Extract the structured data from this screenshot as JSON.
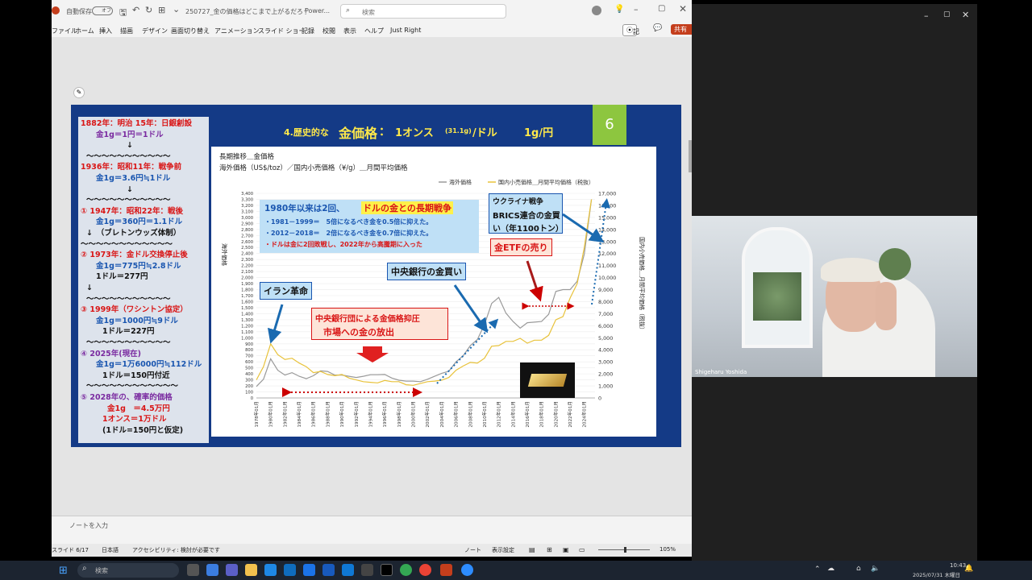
{
  "titlebar": {
    "autosave": "自動保存",
    "toggle": "オフ",
    "filename": "250727_金の価格はどこまで上がるだろうか.pptx",
    "app": "Power...",
    "search_placeholder": "検索"
  },
  "ribbon": {
    "tabs": [
      "ファイル",
      "ホーム",
      "挿入",
      "描画",
      "デザイン",
      "画面切り替え",
      "アニメーション",
      "スライド ショー",
      "記録",
      "校閲",
      "表示",
      "ヘルプ",
      "Just Right"
    ],
    "record": "記録",
    "share": "共有"
  },
  "slide": {
    "number": "6",
    "title_prefix": "4.歴史的な",
    "title_main": "金価格",
    "title_colon": "：",
    "title_unit": "1オンス",
    "title_gram": "(31.1g)",
    "title_per": "/ドル",
    "title_right": "1g/円",
    "left_panel": [
      {
        "text": "1882年：明治 15年：日銀創設",
        "color": "red"
      },
      {
        "text": "金1g＝1円＝1ドル",
        "color": "purp"
      },
      {
        "text": "↓",
        "color": "blk"
      },
      {
        "text": "～～～～～～～～～～～",
        "color": "blk"
      },
      {
        "text": "1936年：昭和11年：戦争前",
        "color": "red"
      },
      {
        "text": "金1g＝3.6円≒1ドル",
        "color": "blue"
      },
      {
        "text": "↓",
        "color": "blk"
      },
      {
        "text": "～～～～～～～～～～～",
        "color": "blk"
      },
      {
        "text": "① 1947年：昭和22年：戦後",
        "color": "red"
      },
      {
        "text": "金1g＝360円＝1.1ドル",
        "color": "blue"
      },
      {
        "text": "↓　（ブレトンウッズ体制）",
        "color": "blk"
      },
      {
        "text": "～～～～～～～～～～～～",
        "color": "blk"
      },
      {
        "text": "② 1973年：金ドル交換停止後",
        "color": "red"
      },
      {
        "text": "金1g＝775円≒2.8ドル",
        "color": "blue"
      },
      {
        "text": "1ドル＝277円",
        "color": "blk"
      },
      {
        "text": "↓",
        "color": "blk"
      },
      {
        "text": "～～～～～～～～～～～",
        "color": "blk"
      },
      {
        "text": "③ 1999年（ワシントン協定）",
        "color": "red"
      },
      {
        "text": "金1g＝1000円≒9ドル",
        "color": "blue"
      },
      {
        "text": "1ドル＝227円",
        "color": "blk"
      },
      {
        "text": "～～～～～～～～～～～",
        "color": "blk"
      },
      {
        "text": "④ 2025年(現在)",
        "color": "purp"
      },
      {
        "text": "金1g＝1万6000円≒112ドル",
        "color": "blue"
      },
      {
        "text": "1ドル＝150円付近",
        "color": "blk"
      },
      {
        "text": "～～～～～～～～～～～～",
        "color": "blk"
      },
      {
        "text": "⑤ 2028年の、確率的価格",
        "color": "purp"
      },
      {
        "text": "金1g　＝4.5万円",
        "color": "red"
      },
      {
        "text": "1オンス＝1万ドル",
        "color": "red"
      },
      {
        "text": "(1ドル=150円と仮定)",
        "color": "blk"
      }
    ],
    "annotations": {
      "box1_title": "1980年以来は2回、",
      "box1_title_hl": "ドルの金との長期戦争",
      "box1_l1": "・1981－1999＝　5倍になるべき金を0.5倍に抑えた。",
      "box1_l2": "・2012－2018＝　2倍になるべき金を0.7倍に抑えた。",
      "box1_l3": "・ドルは金に2回敗戦し、2022年から高騰期に入った",
      "iran": "イラン革命",
      "cb_buy": "中央銀行の金買い",
      "ukraine_1": "ウクライナ戦争",
      "ukraine_2": "BRICS連合の金買",
      "ukraine_3": "い（年1100トン）",
      "etf": "金ETFの売り",
      "suppress_1": "中央銀行団による金価格抑圧",
      "suppress_2": "市場への金の放出"
    }
  },
  "chart_data": {
    "type": "line",
    "title": "長期推移＿金価格",
    "subtitle": "海外価格（US$/toz）／国内小売価格（¥/g）＿月間平均価格",
    "ylabel": "海外価格",
    "y2label": "国内小売価格＿月間平均価格（税抜）",
    "ylim": [
      0,
      3400
    ],
    "y2lim": [
      0,
      17000
    ],
    "y_ticks": [
      "3,400",
      "3,300",
      "3,200",
      "3,100",
      "3,000",
      "2,900",
      "2,800",
      "2,700",
      "2,600",
      "2,500",
      "2,400",
      "2,300",
      "2,200",
      "2,100",
      "2,000",
      "1,900",
      "1,800",
      "1,700",
      "1,600",
      "1,500",
      "1,400",
      "1,300",
      "1,200",
      "1,100",
      "1,000",
      "900",
      "800",
      "700",
      "600",
      "500",
      "400",
      "300",
      "200",
      "100",
      "0"
    ],
    "y2_ticks": [
      "17,000",
      "16,000",
      "15,000",
      "14,000",
      "13,000",
      "12,000",
      "11,000",
      "10,000",
      "9,000",
      "8,000",
      "7,000",
      "6,000",
      "5,000",
      "4,000",
      "3,000",
      "2,000",
      "1,000",
      "0"
    ],
    "x_ticks": [
      "1978年01月",
      "1980年01月",
      "1982年01月",
      "1984年01月",
      "1986年01月",
      "1988年01月",
      "1990年01月",
      "1992年01月",
      "1994年01月",
      "1996年01月",
      "1998年01月",
      "2000年01月",
      "2002年01月",
      "2004年01月",
      "2006年01月",
      "2008年01月",
      "2010年01月",
      "2012年01月",
      "2014年01月",
      "2016年01月",
      "2018年01月",
      "2020年01月",
      "2022年01月",
      "2024年01月"
    ],
    "legend": [
      "海外価格",
      "国内小売価格＿月間平均価格（税抜）"
    ],
    "legend_position": "top-right",
    "series": [
      {
        "name": "海外価格",
        "color": "#9a9a9a",
        "x": [
          1978,
          1979,
          1980,
          1981,
          1982,
          1983,
          1984,
          1985,
          1986,
          1987,
          1988,
          1989,
          1990,
          1991,
          1992,
          1993,
          1994,
          1995,
          1996,
          1997,
          1998,
          1999,
          2000,
          2001,
          2002,
          2003,
          2004,
          2005,
          2006,
          2007,
          2008,
          2009,
          2010,
          2011,
          2012,
          2013,
          2014,
          2015,
          2016,
          2017,
          2018,
          2019,
          2020,
          2021,
          2022,
          2023,
          2024,
          2025
        ],
        "values": [
          190,
          310,
          650,
          460,
          380,
          420,
          360,
          320,
          370,
          450,
          440,
          380,
          380,
          360,
          340,
          360,
          385,
          385,
          390,
          330,
          295,
          280,
          280,
          270,
          310,
          360,
          410,
          445,
          600,
          700,
          870,
          970,
          1220,
          1570,
          1670,
          1410,
          1270,
          1160,
          1250,
          1260,
          1270,
          1390,
          1770,
          1800,
          1800,
          1940,
          2390,
          3300
        ]
      },
      {
        "name": "国内小売価格＿月間平均価格（税抜）",
        "color": "#e8c23a",
        "x": [
          1978,
          1979,
          1980,
          1981,
          1982,
          1983,
          1984,
          1985,
          1986,
          1987,
          1988,
          1989,
          1990,
          1991,
          1992,
          1993,
          1994,
          1995,
          1996,
          1997,
          1998,
          1999,
          2000,
          2001,
          2002,
          2003,
          2004,
          2005,
          2006,
          2007,
          2008,
          2009,
          2010,
          2011,
          2012,
          2013,
          2014,
          2015,
          2016,
          2017,
          2018,
          2019,
          2020,
          2021,
          2022,
          2023,
          2024,
          2025
        ],
        "values": [
          1500,
          2600,
          4500,
          3600,
          3200,
          3300,
          2900,
          2600,
          2100,
          2200,
          1950,
          1850,
          1950,
          1650,
          1500,
          1350,
          1300,
          1250,
          1450,
          1350,
          1350,
          1100,
          1050,
          1200,
          1350,
          1400,
          1480,
          1700,
          2300,
          2650,
          2950,
          2900,
          3300,
          4300,
          4350,
          4700,
          4700,
          4950,
          4550,
          4800,
          4800,
          5200,
          6500,
          6750,
          8300,
          9500,
          12500,
          16500
        ]
      }
    ]
  },
  "notes": {
    "placeholder": "ノートを入力"
  },
  "statusbar": {
    "slide": "スライド 6/17",
    "language": "日本語",
    "accessibility": "アクセシビリティ: 検討が必要です",
    "notes": "ノート",
    "display": "表示設定",
    "zoom": "105%"
  },
  "video": {
    "name": "Shigeharu Yoshida"
  },
  "taskbar": {
    "search_placeholder": "検索",
    "time": "10:43",
    "date": "2025/07/31 木曜日"
  }
}
